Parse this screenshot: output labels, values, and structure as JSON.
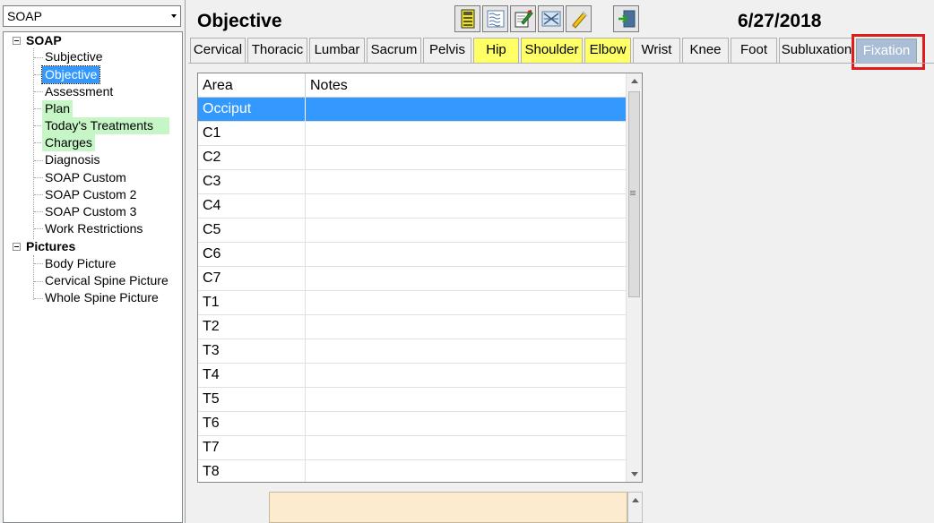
{
  "note_type_select": {
    "value": "SOAP"
  },
  "tree": {
    "soap": {
      "label": "SOAP",
      "items": [
        {
          "label": "Subjective"
        },
        {
          "label": "Objective"
        },
        {
          "label": "Assessment"
        },
        {
          "label": "Plan"
        },
        {
          "label": "Today's Treatments"
        },
        {
          "label": "Charges"
        },
        {
          "label": "Diagnosis"
        },
        {
          "label": "SOAP Custom"
        },
        {
          "label": "SOAP Custom 2"
        },
        {
          "label": "SOAP Custom 3"
        },
        {
          "label": "Work Restrictions"
        }
      ]
    },
    "pictures": {
      "label": "Pictures",
      "items": [
        {
          "label": "Body Picture"
        },
        {
          "label": "Cervical Spine Picture"
        },
        {
          "label": "Whole Spine Picture"
        }
      ]
    }
  },
  "header": {
    "title": "Objective",
    "date": "6/27/2018"
  },
  "toolbar": {
    "buttons": [
      "save-icon",
      "notes-list-icon",
      "edit-note-icon",
      "compare-icon",
      "highlighter-icon",
      "exit-icon"
    ]
  },
  "tabs": [
    {
      "label": "Cervical"
    },
    {
      "label": "Thoracic"
    },
    {
      "label": "Lumbar"
    },
    {
      "label": "Sacrum"
    },
    {
      "label": "Pelvis"
    },
    {
      "label": "Hip"
    },
    {
      "label": "Shoulder"
    },
    {
      "label": "Elbow"
    },
    {
      "label": "Wrist"
    },
    {
      "label": "Knee"
    },
    {
      "label": "Foot"
    },
    {
      "label": "Subluxation"
    },
    {
      "label": "Fixation"
    }
  ],
  "grid": {
    "columns": [
      "Area",
      "Notes"
    ],
    "rows": [
      {
        "area": "Occiput",
        "notes": ""
      },
      {
        "area": "C1",
        "notes": ""
      },
      {
        "area": "C2",
        "notes": ""
      },
      {
        "area": "C3",
        "notes": ""
      },
      {
        "area": "C4",
        "notes": ""
      },
      {
        "area": "C5",
        "notes": ""
      },
      {
        "area": "C6",
        "notes": ""
      },
      {
        "area": "C7",
        "notes": ""
      },
      {
        "area": "T1",
        "notes": ""
      },
      {
        "area": "T2",
        "notes": ""
      },
      {
        "area": "T3",
        "notes": ""
      },
      {
        "area": "T4",
        "notes": ""
      },
      {
        "area": "T5",
        "notes": ""
      },
      {
        "area": "T6",
        "notes": ""
      },
      {
        "area": "T7",
        "notes": ""
      },
      {
        "area": "T8",
        "notes": ""
      }
    ]
  },
  "colors": {
    "selected_row": "#3399ff",
    "tab_yellow": "#ffff66",
    "tree_green": "#c6f5c6",
    "active_tab": "#a9bdd6",
    "highlight_box": "#e01b1b",
    "notes_box": "#fdebd0"
  }
}
